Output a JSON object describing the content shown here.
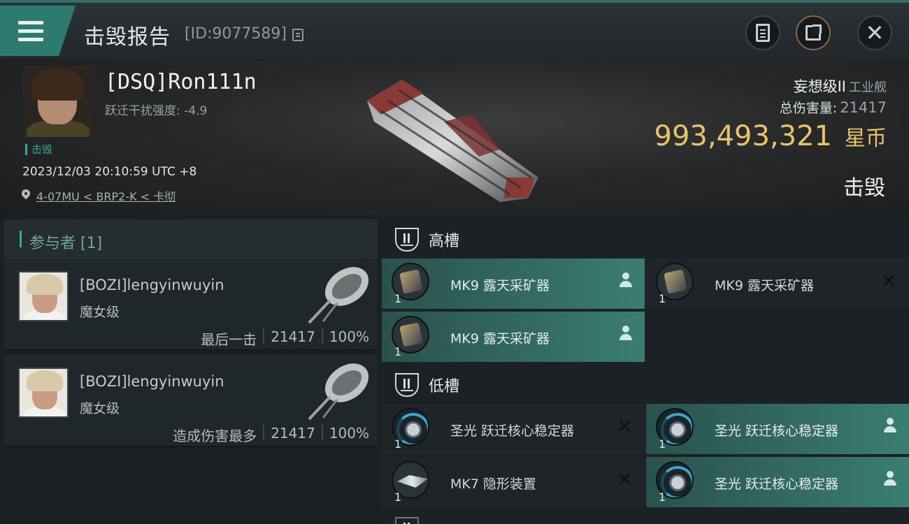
{
  "header": {
    "title": "击毁报告",
    "report_id": "[ID:9077589]"
  },
  "victim": {
    "name": "[DSQ]Ron111n",
    "disruption": "跃迁干扰强度: -4.9",
    "status": "击毁",
    "time": "2023/12/03 20:10:59 UTC +8",
    "location": "4-07MU < BRP2-K < 卡彻",
    "ship_name": "妄想级II",
    "ship_class": "工业舰",
    "total_damage_label": "总伤害量:",
    "total_damage": "21417",
    "isk_value": "993,493,321",
    "isk_unit": "星币",
    "result": "击毁"
  },
  "participants": {
    "header": "参与者 [1]",
    "items": [
      {
        "name": "[BOZI]lengyinwuyin",
        "ship": "魔女级",
        "role": "最后一击",
        "damage": "21417",
        "percent": "100%"
      },
      {
        "name": "[BOZI]lengyinwuyin",
        "ship": "魔女级",
        "role": "造成伤害最多",
        "damage": "21417",
        "percent": "100%"
      }
    ]
  },
  "fitting": {
    "high_label": "高槽",
    "low_label": "低槽",
    "high": [
      {
        "name": "MK9 露天采矿器",
        "qty": "1",
        "state": "fitted"
      },
      {
        "name": "MK9 露天采矿器",
        "qty": "1",
        "state": "destroyed"
      },
      {
        "name": "MK9 露天采矿器",
        "qty": "1",
        "state": "fitted"
      }
    ],
    "low": [
      {
        "name": "圣光 跃迁核心稳定器",
        "qty": "1",
        "state": "destroyed"
      },
      {
        "name": "圣光 跃迁核心稳定器",
        "qty": "1",
        "state": "fitted"
      },
      {
        "name": "MK7 隐形装置",
        "qty": "1",
        "state": "destroyed"
      },
      {
        "name": "圣光 跃迁核心稳定器",
        "qty": "1",
        "state": "fitted"
      }
    ]
  },
  "colors": {
    "accent": "#3fa795",
    "isk": "#e9c36c",
    "fitted_row": "#3a7d73"
  }
}
